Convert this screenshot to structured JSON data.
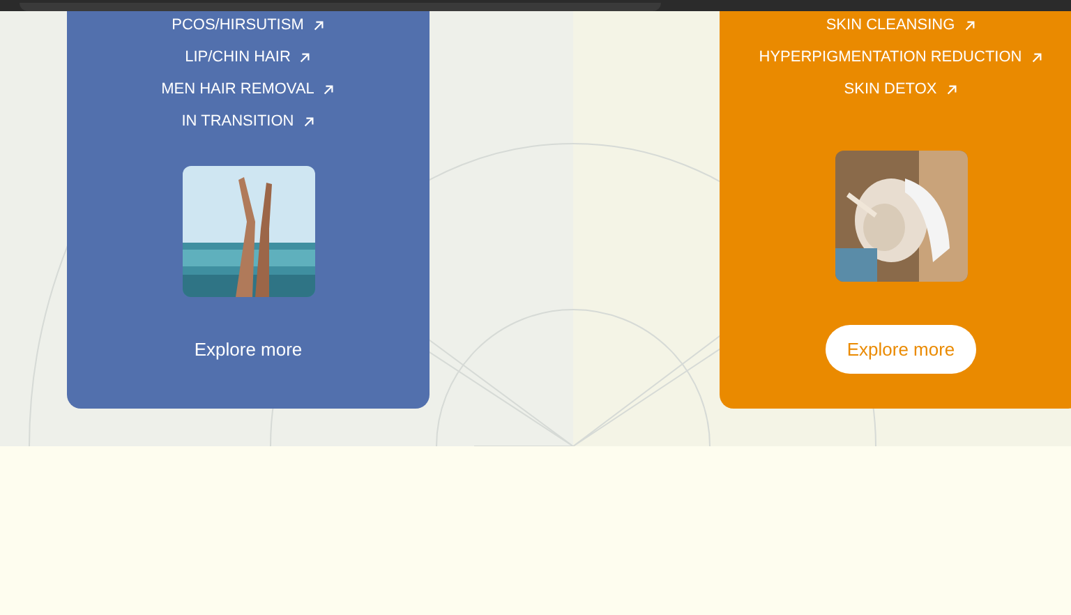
{
  "cards": [
    {
      "color": "#5270ad",
      "links": [
        "PCOS/HIRSUTISM",
        "LIP/CHIN HAIR",
        "MEN HAIR REMOVAL",
        "IN TRANSITION"
      ],
      "picture": {
        "kind": "picture"
      },
      "button": {
        "label": "Explore more",
        "kind": "text"
      }
    },
    {
      "color": "#ea8a00",
      "links": [
        "SKIN CLEANSING",
        "HYPERPIGMENTATION REDUCTION",
        "SKIN DETOX"
      ],
      "picture": {
        "kind": "picture"
      },
      "button": {
        "label": "Explore more",
        "kind": "pill"
      }
    }
  ]
}
